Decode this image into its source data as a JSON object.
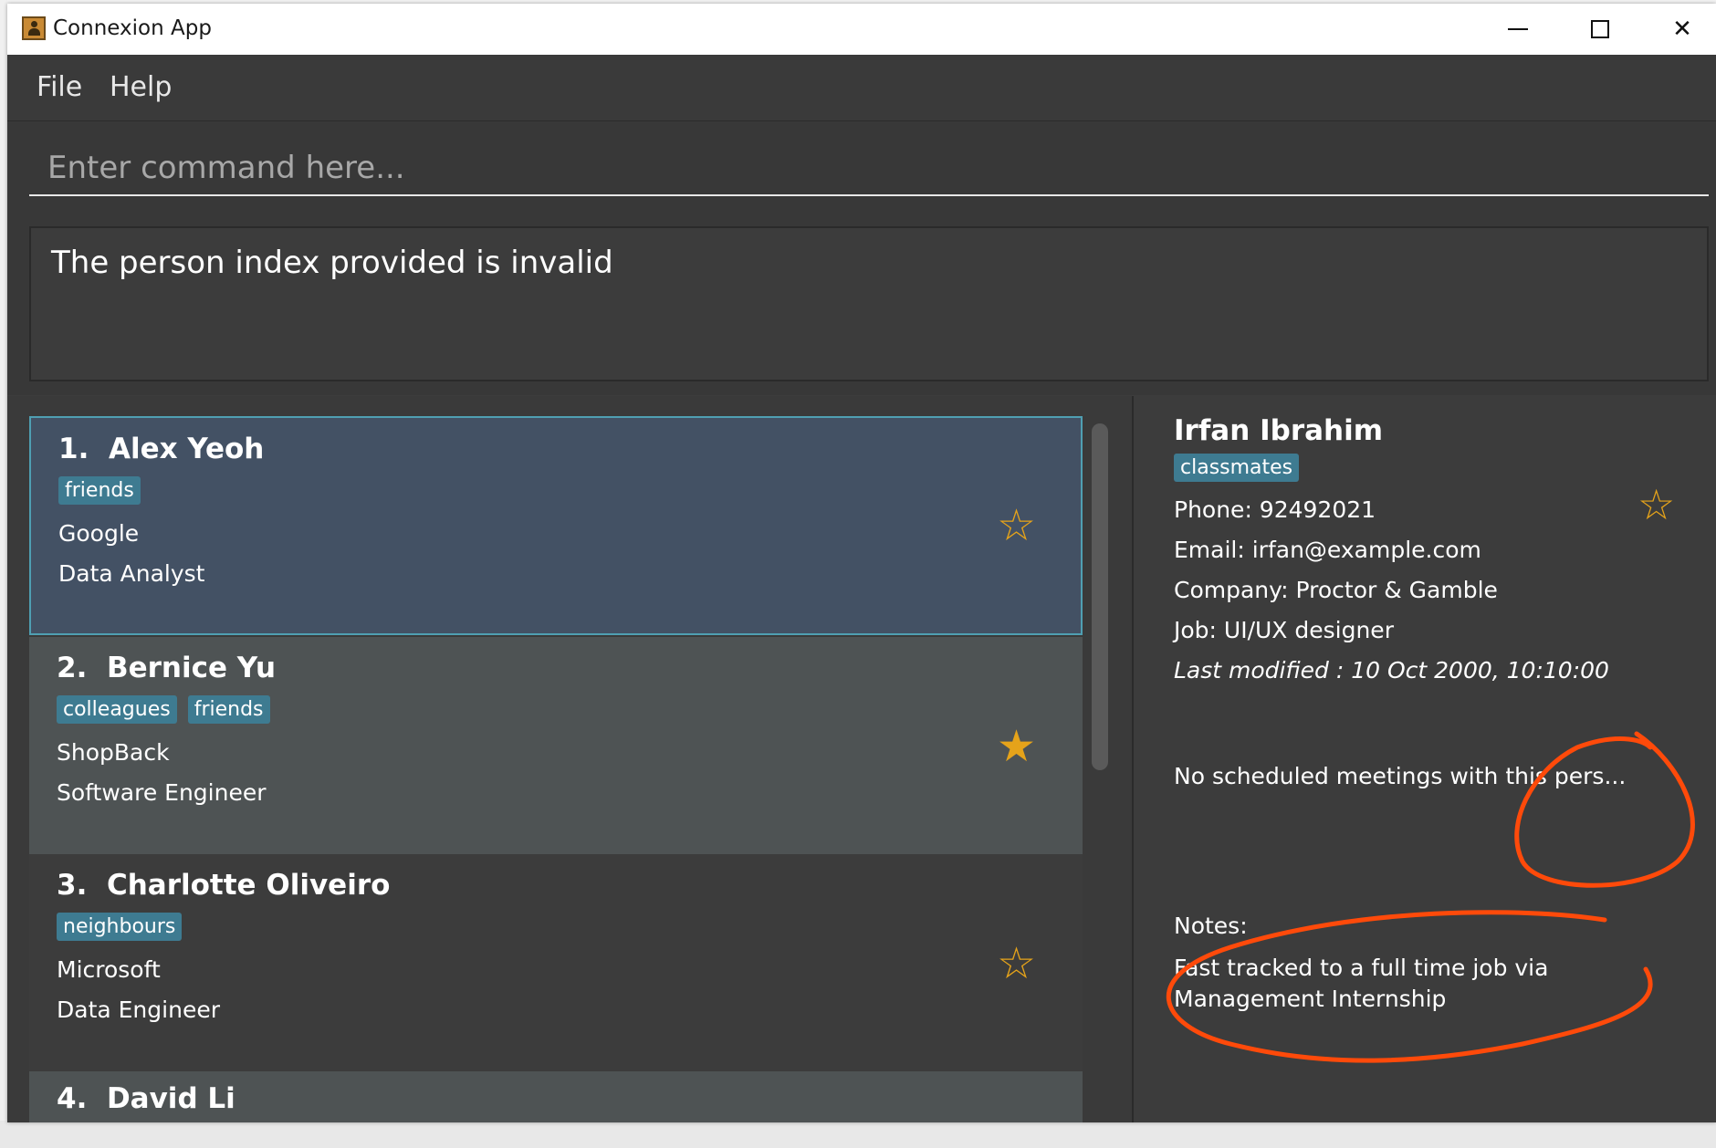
{
  "window": {
    "title": "Connexion App",
    "controls": {
      "minimize": "minimize",
      "maximize": "maximize",
      "close": "✕"
    }
  },
  "menu": {
    "file": "File",
    "help": "Help"
  },
  "command": {
    "placeholder": "Enter command here...",
    "value": ""
  },
  "result": {
    "message": "The person index provided is invalid"
  },
  "contacts": [
    {
      "index": "1.",
      "name": "Alex Yeoh",
      "tags": [
        "friends"
      ],
      "company": "Google",
      "job": "Data Analyst",
      "favourite": false,
      "selected": true
    },
    {
      "index": "2.",
      "name": "Bernice Yu",
      "tags": [
        "colleagues",
        "friends"
      ],
      "company": "ShopBack",
      "job": "Software Engineer",
      "favourite": true,
      "selected": false
    },
    {
      "index": "3.",
      "name": "Charlotte Oliveiro",
      "tags": [
        "neighbours"
      ],
      "company": "Microsoft",
      "job": "Data Engineer",
      "favourite": false,
      "selected": false
    },
    {
      "index": "4.",
      "name": "David Li",
      "tags": [],
      "company": "",
      "job": "",
      "favourite": false,
      "selected": false
    }
  ],
  "detail": {
    "name": "Irfan Ibrahim",
    "tags": [
      "classmates"
    ],
    "phone": "Phone: 92492021",
    "email": "Email: irfan@example.com",
    "company": "Company: Proctor & Gamble",
    "job": "Job: UI/UX designer",
    "last_modified": "Last modified : 10 Oct 2000, 10:10:00",
    "meetings": "No scheduled meetings with this pers...",
    "notes_label": "Notes:",
    "notes": "Fast tracked to a full time job via Management Internship",
    "favourite": false
  },
  "icons": {
    "star_empty": "☆",
    "star_filled": "★"
  },
  "colors": {
    "accent_star": "#e5a31a",
    "tag_bg": "#3e7b91",
    "annotation": "#ff4a0a"
  }
}
